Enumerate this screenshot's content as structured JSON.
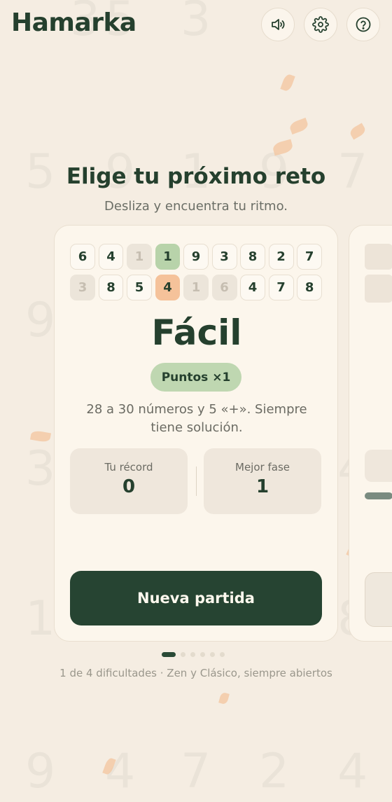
{
  "app": {
    "title": "Hamarka"
  },
  "header_buttons": {
    "sound_icon": "speaker-icon",
    "settings_icon": "gear-icon",
    "help_icon": "help-icon"
  },
  "background_digits": [
    "3",
    "5",
    "3",
    "5",
    "9",
    "1",
    "9",
    "7",
    "9",
    "3",
    "4",
    "1",
    "9",
    "1",
    "8",
    "9",
    "4",
    "7",
    "2",
    "4"
  ],
  "picker": {
    "heading": "Elige tu próximo reto",
    "subheading": "Desliza y encuentra tu ritmo."
  },
  "card": {
    "tiles_row1": [
      {
        "v": "6",
        "s": "normal"
      },
      {
        "v": "4",
        "s": "normal"
      },
      {
        "v": "1",
        "s": "muted"
      },
      {
        "v": "1",
        "s": "green"
      },
      {
        "v": "9",
        "s": "normal"
      },
      {
        "v": "3",
        "s": "normal"
      },
      {
        "v": "8",
        "s": "normal"
      },
      {
        "v": "2",
        "s": "normal"
      },
      {
        "v": "7",
        "s": "normal"
      }
    ],
    "tiles_row2": [
      {
        "v": "3",
        "s": "muted"
      },
      {
        "v": "8",
        "s": "normal"
      },
      {
        "v": "5",
        "s": "normal"
      },
      {
        "v": "4",
        "s": "orange"
      },
      {
        "v": "1",
        "s": "muted"
      },
      {
        "v": "6",
        "s": "muted"
      },
      {
        "v": "4",
        "s": "normal"
      },
      {
        "v": "7",
        "s": "normal"
      },
      {
        "v": "8",
        "s": "normal"
      }
    ],
    "level": "Fácil",
    "points_badge": "Puntos ×1",
    "description": "28 a 30 números y 5 «+». Siempre tiene solución.",
    "record_label": "Tu récord",
    "record_value": "0",
    "best_phase_label": "Mejor fase",
    "best_phase_value": "1",
    "new_game_label": "Nueva partida"
  },
  "pagination": {
    "total": 6,
    "active": 0
  },
  "footer": "1 de 4 dificultades · Zen y Clásico, siempre abiertos",
  "colors": {
    "background": "#f5ede2",
    "primary": "#264432",
    "green_tile": "#b8d3aa",
    "orange_tile": "#f5c29a",
    "badge": "#bfd7b1"
  }
}
